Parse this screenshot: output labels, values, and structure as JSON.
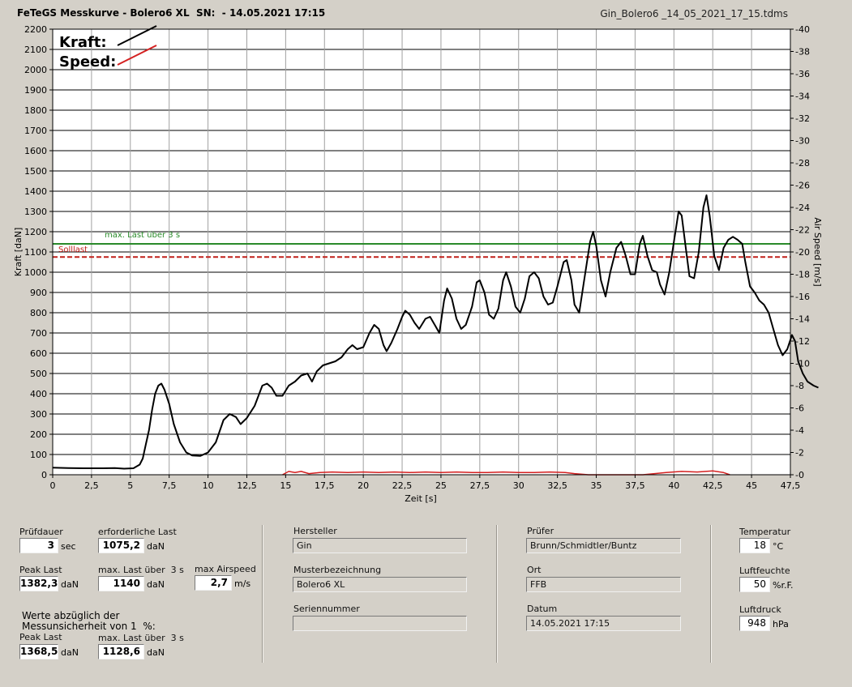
{
  "header": {
    "title": "FeTeGS Messkurve - Bolero6 XL  SN:  - 14.05.2021 17:15",
    "file": "Gin_Bolero6 _14_05_2021_17_15.tdms"
  },
  "chart_data": {
    "type": "line",
    "xlabel": "Zeit [s]",
    "ylabel": "Kraft [daN]",
    "y2label": "Air Speed [m/s]",
    "xlim": [
      0,
      47.5
    ],
    "ylim": [
      0,
      2200
    ],
    "y2lim": [
      0,
      40
    ],
    "x_ticks": [
      "0",
      "2,5",
      "5",
      "7,5",
      "10",
      "12,5",
      "15",
      "17,5",
      "20",
      "22,5",
      "25",
      "27,5",
      "30",
      "32,5",
      "35",
      "37,5",
      "40",
      "42,5",
      "45",
      "47,5"
    ],
    "y_ticks": [
      "0",
      "100",
      "200",
      "300",
      "400",
      "500",
      "600",
      "700",
      "800",
      "900",
      "1000",
      "1100",
      "1200",
      "1300",
      "1400",
      "1500",
      "1600",
      "1700",
      "1800",
      "1900",
      "2000",
      "2100",
      "2200"
    ],
    "y2_ticks": [
      "0",
      "2",
      "4",
      "6",
      "8",
      "10",
      "12",
      "14",
      "16",
      "18",
      "20",
      "22",
      "24",
      "26",
      "28",
      "30",
      "32",
      "34",
      "36",
      "38",
      "40"
    ],
    "grid": true,
    "legend": {
      "placement": "top-left",
      "entries": [
        {
          "label": "Kraft:",
          "color": "#000000"
        },
        {
          "label": "Speed:",
          "color": "#d42020"
        }
      ]
    },
    "reference_lines": [
      {
        "label": "max. Last über  3 s",
        "value": 1140,
        "color": "#2a8a2a",
        "style": "solid"
      },
      {
        "label": "Solllast",
        "value": 1075.2,
        "color": "#c0201a",
        "style": "dashed"
      }
    ],
    "series": [
      {
        "name": "Kraft:",
        "axis": "left",
        "color": "#000000",
        "points": [
          [
            0,
            35
          ],
          [
            1,
            33
          ],
          [
            2,
            32
          ],
          [
            3,
            32
          ],
          [
            4,
            33
          ],
          [
            4.6,
            30
          ],
          [
            5.2,
            32
          ],
          [
            5.6,
            50
          ],
          [
            5.8,
            80
          ],
          [
            6.0,
            150
          ],
          [
            6.2,
            220
          ],
          [
            6.4,
            320
          ],
          [
            6.6,
            400
          ],
          [
            6.8,
            440
          ],
          [
            7.0,
            450
          ],
          [
            7.2,
            420
          ],
          [
            7.5,
            350
          ],
          [
            7.8,
            250
          ],
          [
            8.2,
            160
          ],
          [
            8.6,
            110
          ],
          [
            9.0,
            95
          ],
          [
            9.5,
            93
          ],
          [
            10.0,
            110
          ],
          [
            10.5,
            160
          ],
          [
            11.0,
            270
          ],
          [
            11.4,
            300
          ],
          [
            11.8,
            285
          ],
          [
            12.1,
            250
          ],
          [
            12.5,
            280
          ],
          [
            13.0,
            340
          ],
          [
            13.5,
            440
          ],
          [
            13.8,
            450
          ],
          [
            14.1,
            430
          ],
          [
            14.4,
            390
          ],
          [
            14.8,
            390
          ],
          [
            15.2,
            440
          ],
          [
            15.6,
            460
          ],
          [
            16.0,
            490
          ],
          [
            16.4,
            500
          ],
          [
            16.7,
            460
          ],
          [
            17.0,
            510
          ],
          [
            17.4,
            540
          ],
          [
            17.8,
            550
          ],
          [
            18.2,
            560
          ],
          [
            18.6,
            580
          ],
          [
            19.0,
            620
          ],
          [
            19.3,
            640
          ],
          [
            19.6,
            620
          ],
          [
            20.0,
            630
          ],
          [
            20.4,
            700
          ],
          [
            20.7,
            740
          ],
          [
            21.0,
            720
          ],
          [
            21.3,
            640
          ],
          [
            21.5,
            610
          ],
          [
            21.8,
            650
          ],
          [
            22.2,
            720
          ],
          [
            22.5,
            780
          ],
          [
            22.7,
            810
          ],
          [
            23.0,
            790
          ],
          [
            23.3,
            750
          ],
          [
            23.6,
            720
          ],
          [
            24.0,
            770
          ],
          [
            24.3,
            780
          ],
          [
            24.6,
            740
          ],
          [
            24.9,
            700
          ],
          [
            25.2,
            860
          ],
          [
            25.4,
            920
          ],
          [
            25.7,
            870
          ],
          [
            26.0,
            770
          ],
          [
            26.3,
            720
          ],
          [
            26.6,
            740
          ],
          [
            27.0,
            830
          ],
          [
            27.3,
            950
          ],
          [
            27.5,
            960
          ],
          [
            27.8,
            900
          ],
          [
            28.1,
            790
          ],
          [
            28.4,
            770
          ],
          [
            28.7,
            820
          ],
          [
            29.0,
            960
          ],
          [
            29.2,
            1000
          ],
          [
            29.5,
            930
          ],
          [
            29.8,
            830
          ],
          [
            30.1,
            800
          ],
          [
            30.4,
            870
          ],
          [
            30.7,
            980
          ],
          [
            31.0,
            1000
          ],
          [
            31.3,
            970
          ],
          [
            31.6,
            880
          ],
          [
            31.9,
            840
          ],
          [
            32.2,
            850
          ],
          [
            32.5,
            930
          ],
          [
            32.9,
            1050
          ],
          [
            33.1,
            1060
          ],
          [
            33.4,
            960
          ],
          [
            33.6,
            840
          ],
          [
            33.9,
            800
          ],
          [
            34.2,
            950
          ],
          [
            34.6,
            1150
          ],
          [
            34.8,
            1200
          ],
          [
            35.0,
            1130
          ],
          [
            35.3,
            960
          ],
          [
            35.6,
            880
          ],
          [
            35.9,
            1000
          ],
          [
            36.3,
            1120
          ],
          [
            36.6,
            1150
          ],
          [
            36.9,
            1080
          ],
          [
            37.2,
            990
          ],
          [
            37.5,
            990
          ],
          [
            37.8,
            1140
          ],
          [
            38.0,
            1180
          ],
          [
            38.3,
            1080
          ],
          [
            38.6,
            1010
          ],
          [
            38.9,
            1000
          ],
          [
            39.1,
            940
          ],
          [
            39.4,
            890
          ],
          [
            39.7,
            1000
          ],
          [
            40.0,
            1150
          ],
          [
            40.3,
            1300
          ],
          [
            40.5,
            1280
          ],
          [
            40.8,
            1100
          ],
          [
            41.0,
            980
          ],
          [
            41.3,
            970
          ],
          [
            41.6,
            1100
          ],
          [
            41.9,
            1320
          ],
          [
            42.1,
            1380
          ],
          [
            42.3,
            1280
          ],
          [
            42.6,
            1080
          ],
          [
            42.9,
            1010
          ],
          [
            43.2,
            1120
          ],
          [
            43.5,
            1160
          ],
          [
            43.8,
            1175
          ],
          [
            44.1,
            1160
          ],
          [
            44.4,
            1140
          ],
          [
            44.6,
            1050
          ],
          [
            44.9,
            930
          ],
          [
            45.2,
            900
          ],
          [
            45.5,
            860
          ],
          [
            45.8,
            840
          ],
          [
            46.1,
            800
          ],
          [
            46.4,
            720
          ],
          [
            46.7,
            640
          ],
          [
            47.0,
            590
          ],
          [
            47.3,
            620
          ],
          [
            47.6,
            690
          ],
          [
            47.8,
            660
          ],
          [
            48.0,
            560
          ],
          [
            48.3,
            500
          ],
          [
            48.6,
            460
          ],
          [
            49.0,
            440
          ],
          [
            49.3,
            430
          ]
        ]
      },
      {
        "name": "Speed:",
        "axis": "right",
        "color": "#d42020",
        "points": [
          [
            14.8,
            0
          ],
          [
            15.2,
            0.3
          ],
          [
            15.6,
            0.2
          ],
          [
            16.0,
            0.3
          ],
          [
            16.5,
            0.1
          ],
          [
            17.2,
            0.2
          ],
          [
            18.0,
            0.25
          ],
          [
            19.0,
            0.2
          ],
          [
            20.0,
            0.25
          ],
          [
            21.0,
            0.2
          ],
          [
            22.0,
            0.25
          ],
          [
            23.0,
            0.2
          ],
          [
            24.0,
            0.25
          ],
          [
            25.0,
            0.2
          ],
          [
            26.0,
            0.25
          ],
          [
            27.0,
            0.2
          ],
          [
            28.0,
            0.2
          ],
          [
            29.0,
            0.25
          ],
          [
            30.0,
            0.2
          ],
          [
            31.0,
            0.2
          ],
          [
            32.0,
            0.25
          ],
          [
            33.0,
            0.2
          ],
          [
            33.6,
            0.1
          ],
          [
            34.5,
            0
          ],
          [
            38.0,
            0
          ],
          [
            39.5,
            0.2
          ],
          [
            40.5,
            0.3
          ],
          [
            41.5,
            0.25
          ],
          [
            42.5,
            0.35
          ],
          [
            43.2,
            0.2
          ],
          [
            43.6,
            0
          ]
        ]
      }
    ]
  },
  "panel": {
    "pruefdauer_label": "Prüfdauer",
    "pruefdauer_value": "3",
    "pruefdauer_unit": "sec",
    "erf_last_label": "erforderliche Last",
    "erf_last_value": "1075,2",
    "erf_last_unit": "daN",
    "peak_label": "Peak Last",
    "peak_value": "1382,3",
    "peak_unit": "daN",
    "maxlast_label": "max. Last über  3 s",
    "maxlast_value": "1140",
    "maxlast_unit": "daN",
    "airspeed_label": "max Airspeed",
    "airspeed_value": "2,7",
    "airspeed_unit": "m/s",
    "note_line1": "Werte abzüglich der",
    "note_line2": "Messunsicherheit von 1  %:",
    "peak2_label": "Peak Last",
    "peak2_value": "1368,5",
    "peak2_unit": "daN",
    "maxlast2_label": "max. Last über  3 s",
    "maxlast2_value": "1128,6",
    "maxlast2_unit": "daN",
    "hersteller_label": "Hersteller",
    "hersteller_value": "Gin",
    "muster_label": "Musterbezeichnung",
    "muster_value": "Bolero6 XL",
    "serien_label": "Seriennummer",
    "serien_value": "",
    "pruefer_label": "Prüfer",
    "pruefer_value": "Brunn/Schmidtler/Buntz",
    "ort_label": "Ort",
    "ort_value": "FFB",
    "datum_label": "Datum",
    "datum_value": "14.05.2021 17:15",
    "temp_label": "Temperatur",
    "temp_value": "18",
    "temp_unit": "°C",
    "feuchte_label": "Luftfeuchte",
    "feuchte_value": "50",
    "feuchte_unit": "%r.F.",
    "druck_label": "Luftdruck",
    "druck_value": "948",
    "druck_unit": "hPa"
  }
}
